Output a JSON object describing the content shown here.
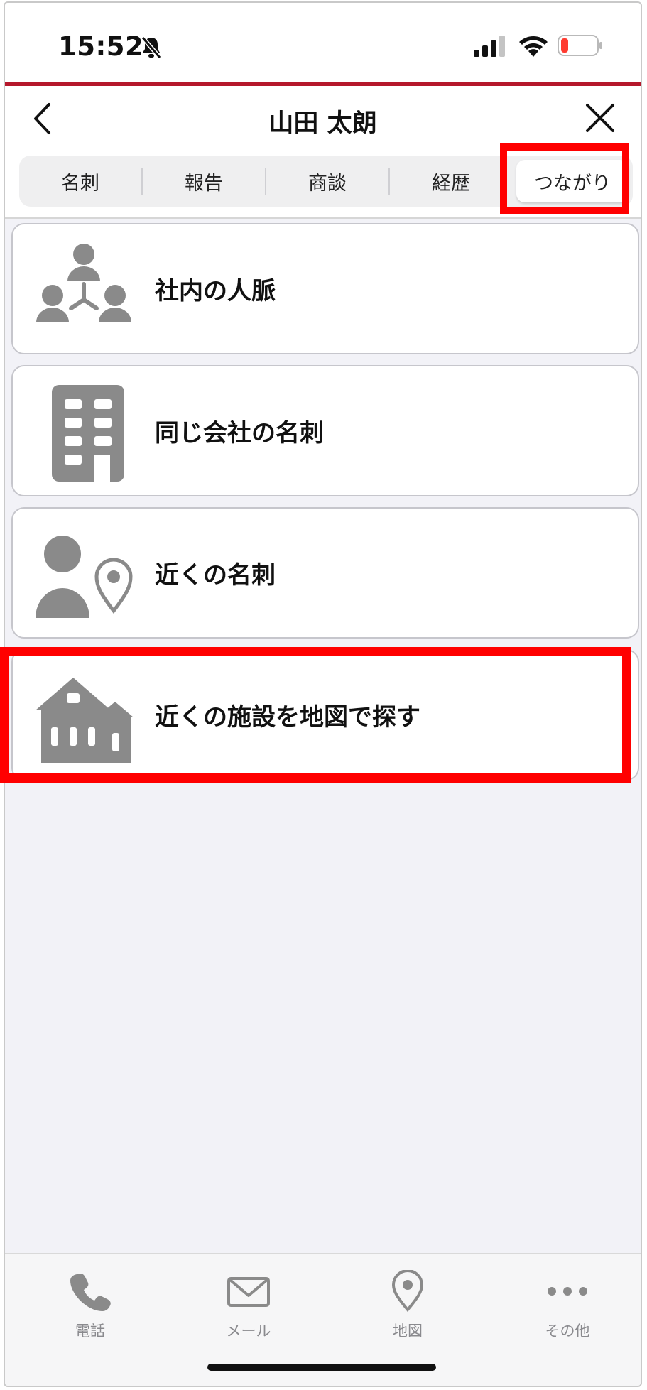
{
  "status_bar": {
    "time": "15:52"
  },
  "nav": {
    "title": "山田 太朗"
  },
  "tabs": [
    {
      "label": "名刺"
    },
    {
      "label": "報告"
    },
    {
      "label": "商談"
    },
    {
      "label": "経歴"
    },
    {
      "label": "つながり",
      "active": true
    }
  ],
  "menu": [
    {
      "label": "社内の人脈",
      "icon": "org-network-icon"
    },
    {
      "label": "同じ会社の名刺",
      "icon": "building-icon"
    },
    {
      "label": "近くの名刺",
      "icon": "person-location-icon"
    },
    {
      "label": "近くの施設を地図で探す",
      "icon": "houses-icon"
    }
  ],
  "bottom_bar": [
    {
      "label": "電話",
      "icon": "phone-icon"
    },
    {
      "label": "メール",
      "icon": "mail-icon"
    },
    {
      "label": "地図",
      "icon": "map-pin-icon"
    },
    {
      "label": "その他",
      "icon": "more-icon"
    }
  ],
  "colors": {
    "accent_line": "#b5172b",
    "highlight": "#ff0000",
    "icon_gray": "#8a8a8a"
  }
}
